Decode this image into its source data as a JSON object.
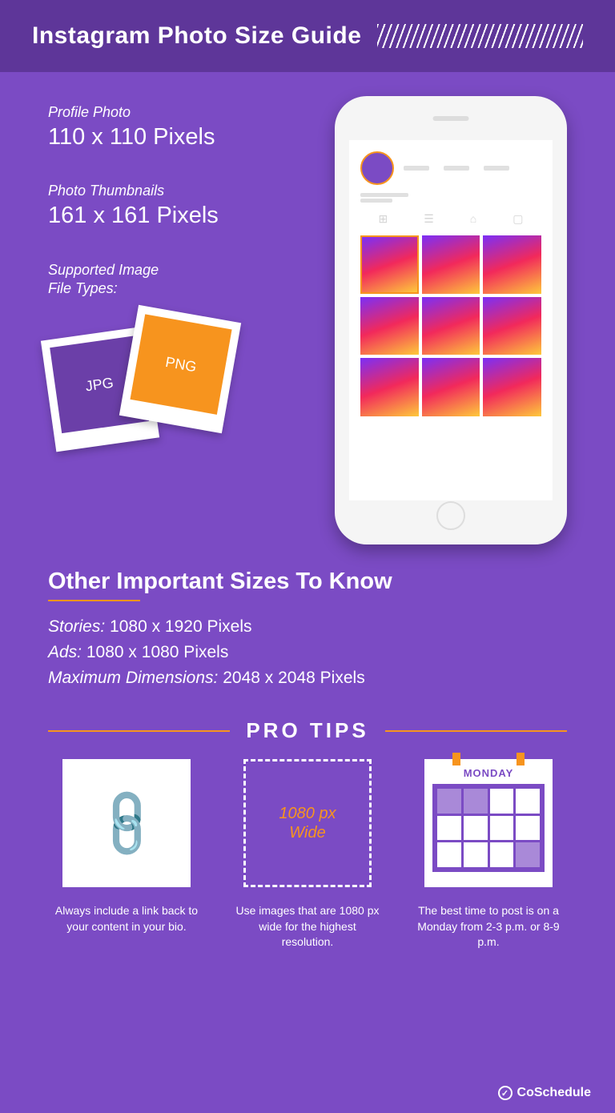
{
  "header": {
    "title": "Instagram Photo Size Guide"
  },
  "sizes": {
    "profile": {
      "label": "Profile Photo",
      "value": "110 x 110 Pixels"
    },
    "thumbnails": {
      "label": "Photo Thumbnails",
      "value": "161 x 161 Pixels"
    },
    "supported_label": "Supported Image\nFile Types:",
    "jpg": "JPG",
    "png": "PNG"
  },
  "other": {
    "heading": "Other Important Sizes To Know",
    "stories": {
      "label": "Stories:",
      "value": "1080 x 1920 Pixels"
    },
    "ads": {
      "label": "Ads:",
      "value": "1080 x 1080 Pixels"
    },
    "max": {
      "label": "Maximum Dimensions:",
      "value": "2048 x 2048 Pixels"
    }
  },
  "protips": {
    "heading": "PRO TIPS",
    "wide_label": "1080 px\nWide",
    "cal_label": "MONDAY",
    "tip1": "Always include a link back to your content in your bio.",
    "tip2": "Use images that are 1080 px wide for the highest resolution.",
    "tip3": "The best time to post is on a Monday from 2-3 p.m. or 8-9 p.m."
  },
  "footer": {
    "brand": "CoSchedule"
  }
}
